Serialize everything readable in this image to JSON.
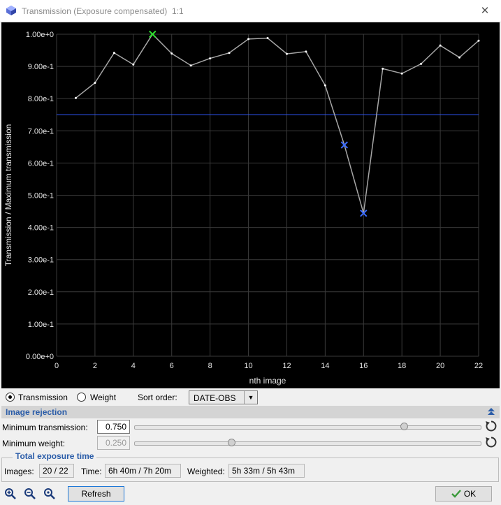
{
  "window": {
    "title": "Transmission (Exposure compensated)",
    "zoom": "1:1",
    "close_glyph": "✕",
    "icon": "app-cube-icon"
  },
  "chart_data": {
    "type": "line",
    "xlabel": "nth image",
    "ylabel": "Transmission / Maximum transmission",
    "xlim": [
      0,
      22
    ],
    "ylim": [
      0.0,
      1.0
    ],
    "x_ticks": [
      "0",
      "2",
      "4",
      "6",
      "8",
      "10",
      "12",
      "14",
      "16",
      "18",
      "20",
      "22"
    ],
    "y_ticks": [
      "0.00e+0",
      "1.00e-1",
      "2.00e-1",
      "3.00e-1",
      "4.00e-1",
      "5.00e-1",
      "6.00e-1",
      "7.00e-1",
      "8.00e-1",
      "9.00e-1",
      "1.00e+0"
    ],
    "grid": true,
    "series": [
      {
        "x": [
          1,
          2,
          3,
          4,
          5,
          6,
          7,
          8,
          9,
          10,
          11,
          12,
          13,
          14,
          15,
          16,
          17,
          18,
          19,
          20,
          21,
          22
        ],
        "y": [
          0.802,
          0.849,
          0.942,
          0.906,
          1.0,
          0.94,
          0.903,
          0.925,
          0.942,
          0.985,
          0.988,
          0.939,
          0.946,
          0.841,
          0.656,
          0.444,
          0.893,
          0.878,
          0.908,
          0.965,
          0.928,
          0.98
        ],
        "color": "#a6a6a6"
      }
    ],
    "threshold": {
      "y": 0.75,
      "color": "#2f58ff"
    },
    "markers": [
      {
        "x": 5,
        "y": 1.0,
        "symbol": "x",
        "color": "#2ee02e"
      },
      {
        "x": 15,
        "y": 0.656,
        "symbol": "x",
        "color": "#3b6bff"
      },
      {
        "x": 16,
        "y": 0.444,
        "symbol": "x",
        "color": "#3b6bff"
      }
    ]
  },
  "mode": {
    "transmission_label": "Transmission",
    "weight_label": "Weight",
    "selected": "transmission",
    "sort_label": "Sort order:",
    "sort_value": "DATE-OBS"
  },
  "rejection": {
    "section_title": "Image rejection",
    "min_transmission_label": "Minimum transmission:",
    "min_transmission_value": "0.750",
    "min_transmission_fraction": 0.78,
    "min_weight_label": "Minimum weight:",
    "min_weight_value": "0.250",
    "min_weight_fraction": 0.28
  },
  "exposure": {
    "group_title": "Total exposure time",
    "images_label": "Images:",
    "images_value": "20 / 22",
    "time_label": "Time:",
    "time_value": "6h 40m / 7h 20m",
    "weighted_label": "Weighted:",
    "weighted_value": "5h 33m / 5h 43m"
  },
  "buttons": {
    "refresh": "Refresh",
    "ok": "OK"
  },
  "colors": {
    "accent": "#2a5ca8",
    "ok_check": "#3a9a3a"
  }
}
